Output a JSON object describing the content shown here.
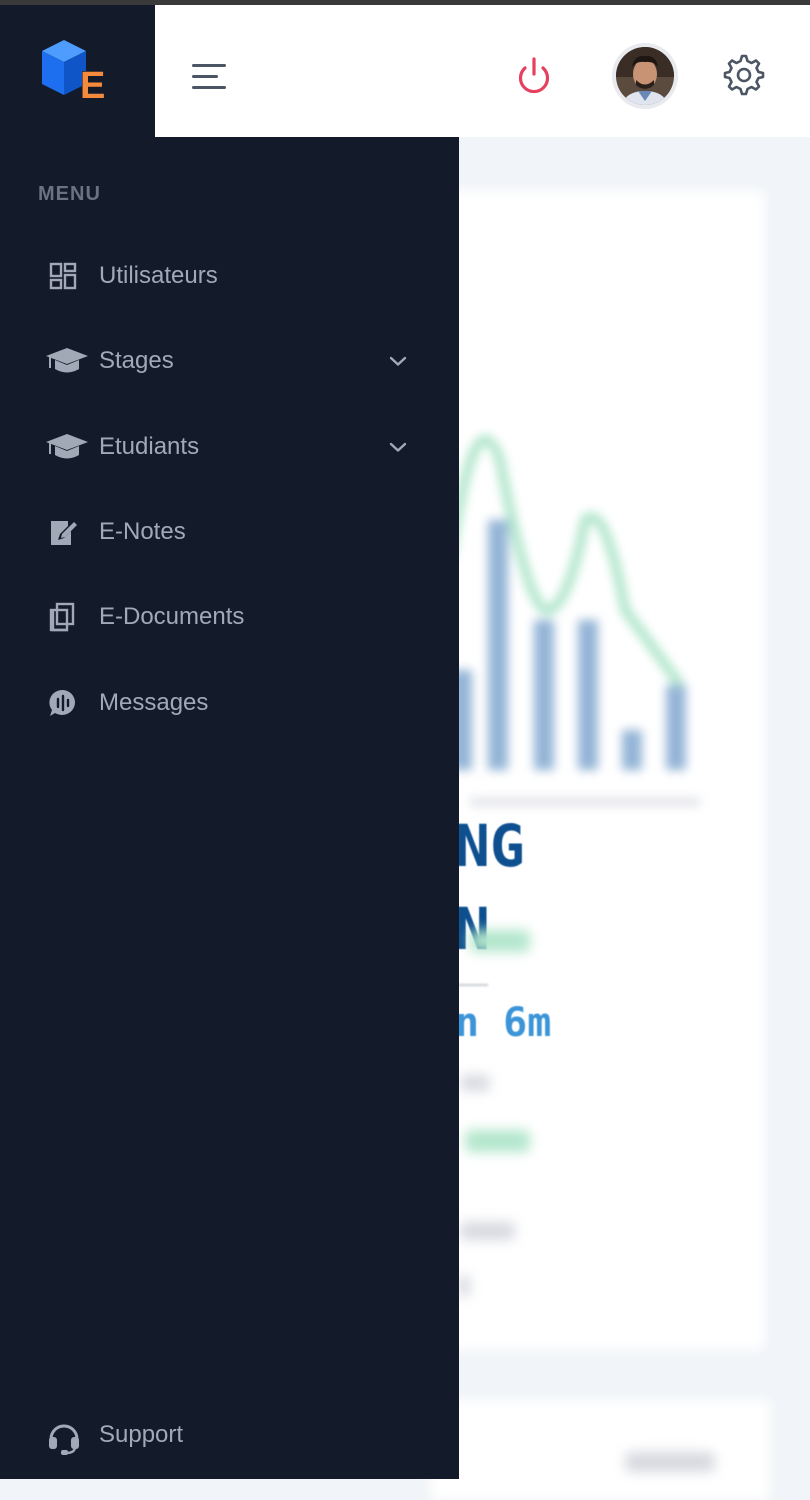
{
  "header": {
    "logo_letter": "E",
    "menu_button": "hamburger-menu",
    "power_button": "power-icon",
    "avatar": "user-avatar",
    "settings_button": "gear-icon"
  },
  "sidebar": {
    "heading": "MENU",
    "items": [
      {
        "label": "Utilisateurs",
        "icon": "dashboard-grid-icon",
        "expandable": false
      },
      {
        "label": "Stages",
        "icon": "graduation-cap-icon",
        "expandable": true
      },
      {
        "label": "Etudiants",
        "icon": "graduation-cap-icon",
        "expandable": true
      },
      {
        "label": "E-Notes",
        "icon": "edit-notes-icon",
        "expandable": false
      },
      {
        "label": "E-Documents",
        "icon": "documents-copy-icon",
        "expandable": false
      },
      {
        "label": "Messages",
        "icon": "chat-bubble-icon",
        "expandable": false
      }
    ],
    "support": {
      "label": "Support",
      "icon": "headset-icon"
    }
  },
  "background": {
    "line1": "NG",
    "line2": "N",
    "line3": "n 6m"
  },
  "colors": {
    "sidebar_bg": "#131a2a",
    "sidebar_text": "#a2a9b6",
    "power": "#e5405e",
    "logo_blue": "#1e6ff0",
    "logo_orange": "#f58a3c",
    "chart_bar": "#93b4d6",
    "chart_line": "#a8e3c6"
  }
}
